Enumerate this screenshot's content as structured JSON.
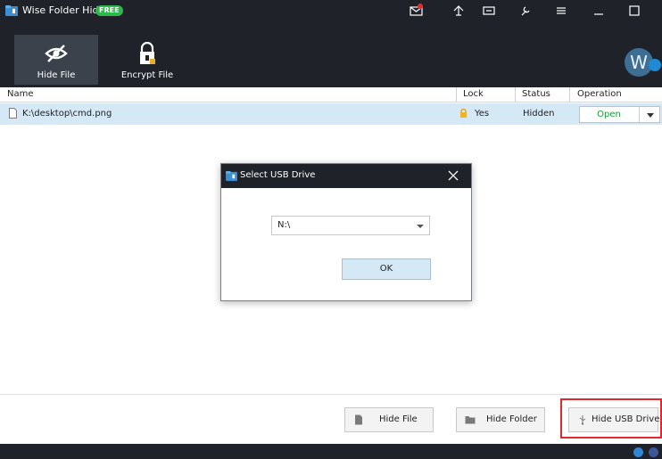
{
  "app": {
    "title": "Wise Folder Hider",
    "badge": "FREE"
  },
  "toolbar_icons": [
    "mail-icon",
    "upload-icon",
    "message-icon",
    "tools-icon",
    "menu-icon",
    "minimize-icon",
    "maximize-icon"
  ],
  "tabs": [
    {
      "label": "Hide File",
      "icon": "eye-off-icon",
      "active": true
    },
    {
      "label": "Encrypt File",
      "icon": "lock-file-icon",
      "active": false
    }
  ],
  "avatar": {
    "initial": "W"
  },
  "table": {
    "columns": [
      "Name",
      "Lock",
      "Status",
      "Operation"
    ],
    "rows": [
      {
        "name": "K:\\desktop\\cmd.png",
        "lock": "Yes",
        "status": "Hidden",
        "operation": "Open"
      }
    ]
  },
  "dialog": {
    "title": "Select USB Drive",
    "drive_value": "N:\\",
    "ok_label": "OK"
  },
  "bottom_buttons": [
    {
      "label": "Hide File",
      "icon": "file-icon"
    },
    {
      "label": "Hide Folder",
      "icon": "folder-icon"
    },
    {
      "label": "Hide USB Drive",
      "icon": "usb-icon"
    }
  ],
  "colors": {
    "header_bg": "#1f2329",
    "accent_green": "#2db84a",
    "row_selected": "#d5e8f6",
    "highlight": "#e0282e"
  }
}
